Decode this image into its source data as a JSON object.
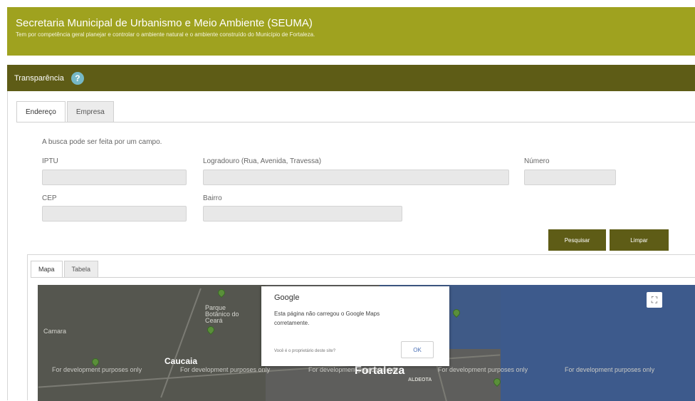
{
  "header": {
    "title": "Secretaria Municipal de Urbanismo e Meio Ambiente (SEUMA)",
    "subtitle": "Tem por competência geral planejar e controlar o ambiente natural e o ambiente construído do Município de Fortaleza."
  },
  "section": {
    "title": "Transparência",
    "help_icon": "?"
  },
  "tabs": [
    "Endereço",
    "Empresa"
  ],
  "search": {
    "hint": "A busca pode ser feita por um campo.",
    "fields": {
      "iptu": {
        "label": "IPTU",
        "value": ""
      },
      "logradouro": {
        "label": "Logradouro (Rua, Avenida, Travessa)",
        "value": ""
      },
      "numero": {
        "label": "Número",
        "value": ""
      },
      "cep": {
        "label": "CEP",
        "value": ""
      },
      "bairro": {
        "label": "Bairro",
        "value": ""
      }
    },
    "search_button": "Pesquisar",
    "clear_button": "Limpar"
  },
  "result_tabs": [
    "Mapa",
    "Tabela"
  ],
  "map": {
    "places": [
      "Parque Botânico do Ceará",
      "Caucaia",
      "Fortaleza",
      "Camara",
      "ALDEOTA"
    ],
    "dev_watermark": "For development purposes only",
    "fullscreen_icon": "⛶",
    "dialog": {
      "brand": "Google",
      "message": "Esta página não carregou o Google Maps corretamente.",
      "owner_prompt": "Você é o proprietário deste site?",
      "ok_label": "OK"
    }
  },
  "colors": {
    "banner": "#9fa21f",
    "section_bar": "#5e5c16",
    "button": "#5e5c16",
    "sea": "#3d5a8c"
  }
}
